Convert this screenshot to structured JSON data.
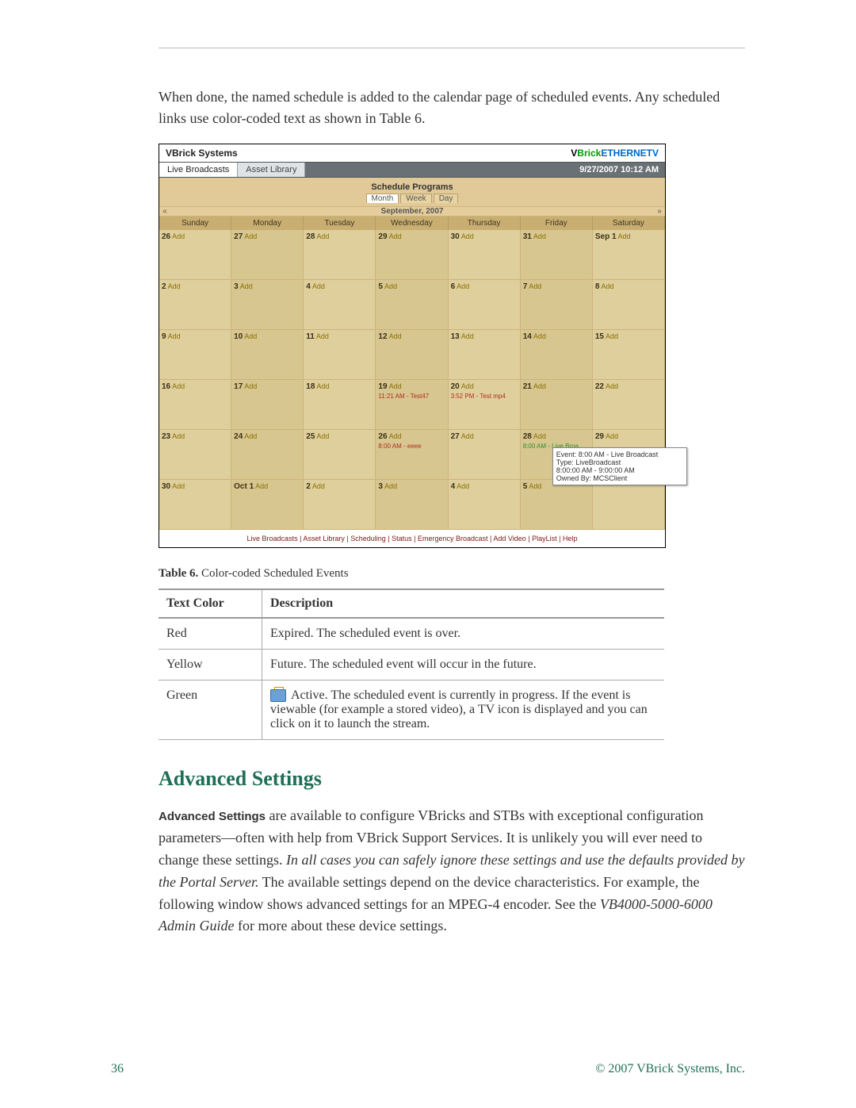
{
  "intro": "When done, the named schedule is added to the calendar page of scheduled events. Any scheduled links use color-coded text as shown in Table 6.",
  "shot": {
    "brand": "VBrick Systems",
    "logo_v": "V",
    "logo_brick": "Brick",
    "logo_eth": "ETHERNETV",
    "tab_live": "Live Broadcasts",
    "tab_asset": "Asset Library",
    "clock": "9/27/2007 10:12 AM",
    "title": "Schedule Programs",
    "view_month": "Month",
    "view_week": "Week",
    "view_day": "Day",
    "nav_prev": "«",
    "nav_next": "»",
    "month_label": "September, 2007",
    "days": [
      "Sunday",
      "Monday",
      "Tuesday",
      "Wednesday",
      "Thursday",
      "Friday",
      "Saturday"
    ],
    "add": "Add",
    "cells": [
      [
        "26",
        "27",
        "28",
        "29",
        "30",
        "31",
        "Sep 1"
      ],
      [
        "2",
        "3",
        "4",
        "5",
        "6",
        "7",
        "8"
      ],
      [
        "9",
        "10",
        "11",
        "12",
        "13",
        "14",
        "15"
      ],
      [
        "16",
        "17",
        "18",
        "19",
        "20",
        "21",
        "22"
      ],
      [
        "23",
        "24",
        "25",
        "26",
        "27",
        "28",
        "29"
      ],
      [
        "30",
        "Oct 1",
        "2",
        "3",
        "4",
        "5",
        ""
      ]
    ],
    "ev_19": "11:21 AM - Test47",
    "ev_20": "3:52 PM - Test mp4",
    "ev_26b": "8:00 AM - eeee",
    "ev_28b": "8:00 AM - Live Broa…",
    "tt_line1": "Event: 8:00 AM - Live Broadcast",
    "tt_line2": "Type: LiveBroadcast",
    "tt_line3": "8:00:00 AM - 9:00:00 AM",
    "tt_line4": "Owned By: MCSClient",
    "footer": "Live Broadcasts | Asset Library | Scheduling | Status | Emergency Broadcast | Add Video | PlayList | Help"
  },
  "caption_bold": "Table 6.",
  "caption_rest": "  Color-coded Scheduled Events",
  "table": {
    "h1": "Text Color",
    "h2": "Description",
    "rows": [
      {
        "c": "Red",
        "d": "Expired. The scheduled event is over."
      },
      {
        "c": "Yellow",
        "d": "Future. The scheduled event will occur in the future."
      },
      {
        "c": "Green",
        "d": "Active. The scheduled event is currently in progress. If the event is viewable (for example a stored video), a TV icon is displayed and you can click on it to launch the stream."
      }
    ]
  },
  "adv_heading": "Advanced Settings",
  "adv_lead_bold": "Advanced Settings",
  "adv_p1a": " are available to configure VBricks and STBs with exceptional configuration parameters—often with help from VBrick Support Services. It is unlikely you will ever need to change these settings. ",
  "adv_p1_ital": "In all cases you can safely ignore these settings and use the defaults provided by the Portal Server.",
  "adv_p1b": " The available settings depend on the device characteristics. For example, the following window shows advanced settings for an MPEG-4 encoder. See the ",
  "adv_p1_ital2": "VB4000-5000-6000 Admin Guide",
  "adv_p1c": " for more about these device settings.",
  "page_no": "36",
  "copyright": "© 2007 VBrick Systems, Inc."
}
